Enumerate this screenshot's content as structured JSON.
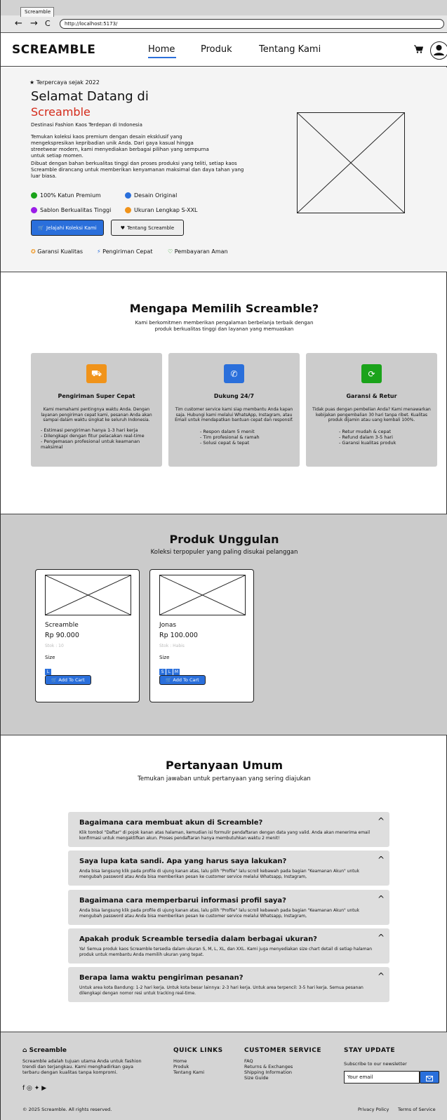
{
  "browser": {
    "tab_title": "Screamble",
    "back": "←",
    "forward": "→",
    "reload": "C",
    "url": "http://localhost:5173/"
  },
  "nav": {
    "brand": "SCREAMBLE",
    "links": [
      "Home",
      "Produk",
      "Tentang Kami"
    ],
    "active": "Home"
  },
  "hero": {
    "badge": "Terpercaya sejak 2022",
    "title_line1": "Selamat Datang di",
    "title_line2": "Screamble",
    "subtitle": "Destinasi Fashion Kaos Terdepan di Indonesia",
    "para1": "Temukan koleksi kaos premium dengan desain eksklusif yang mengekspresikan kepribadian unik Anda. Dari gaya kasual hingga streetwear modern, kami menyediakan berbagai pilihan yang sempurna untuk setiap momen.",
    "para2": "Dibuat dengan bahan berkualitas tinggi dan proses produksi yang teliti, setiap kaos Screamble dirancang untuk memberikan kenyamanan maksimal dan daya tahan yang luar biasa.",
    "features": [
      {
        "label": "100% Katun Premium",
        "color": "#1aa31a"
      },
      {
        "label": "Desain Original",
        "color": "#2a6fdb"
      },
      {
        "label": "Sablon Berkualitas Tinggi",
        "color": "#9b1de8"
      },
      {
        "label": "Ukuran Lengkap S-XXL",
        "color": "#f0931a"
      }
    ],
    "cta_primary": "Jelajahi Koleksi Kami",
    "cta_secondary": "Tentang Screamble",
    "trust": [
      "Garansi Kualitas",
      "Pengiriman Cepat",
      "Pembayaran Aman"
    ]
  },
  "why": {
    "title": "Mengapa Memilih Screamble?",
    "subtitle_line1": "Kami berkomitmen memberikan pengalaman berbelanja terbaik dengan",
    "subtitle_line2": "produk berkualitas tinggi dan layanan yang memuaskan",
    "cards": [
      {
        "icon": "truck-icon",
        "color": "#f0931a",
        "title": "Pengiriman Super Cepat",
        "desc": "Kami memahami pentingnya waktu Anda. Dengan layanan pengiriman cepat kami, pesanan Anda akan sampai dalam waktu singkat ke seluruh Indonesia.",
        "points": [
          "- Estimasi pengiriman hanya 1-3 hari kerja",
          "- Dilengkapi dengan fitur pelacakan real-time",
          "- Pengemasan profesional untuk keamanan maksimal"
        ]
      },
      {
        "icon": "phone-icon",
        "color": "#2a6fdb",
        "title": "Dukung 24/7",
        "desc": "Tim customer service kami siap membantu Anda kapan saja. Hubungi kami melalui WhatsApp, Instagram, atau Email untuk mendapatkan bantuan cepat dan responsif.",
        "points": [
          "- Respon dalam 5 menit",
          "- Tim profesional & ramah",
          "- Solusi cepat & tepat"
        ]
      },
      {
        "icon": "refresh-icon",
        "color": "#1aa31a",
        "title": "Garansi & Retur",
        "desc": "Tidak puas dengan pembelian Anda? Kami menawarkan kebijakan pengembalian 30 hari tanpa ribet. Kualitas produk dijamin atau uang kembali 100%.",
        "points": [
          "- Retur mudah & cepat",
          "- Refund dalam 3-5 hari",
          "- Garansi kualitas produk"
        ]
      }
    ]
  },
  "produk": {
    "title": "Produk Unggulan",
    "subtitle": "Koleksi terpopuler yang paling disukai pelanggan",
    "size_label": "Size",
    "add_label": "Add To Cart",
    "items": [
      {
        "name": "Screamble",
        "price": "Rp 90.000",
        "stock": "Stok : 10",
        "sizes": [
          "L"
        ]
      },
      {
        "name": "Jonas",
        "price": "Rp 100.000",
        "stock": "Stok : Habis",
        "sizes": [
          "S",
          "L",
          "M"
        ]
      }
    ]
  },
  "faq": {
    "title": "Pertanyaan Umum",
    "subtitle": "Temukan jawaban untuk pertanyaan yang sering diajukan",
    "items": [
      {
        "q": "Bagaimana cara membuat akun di Screamble?",
        "a": "Klik tombol \"Daftar\" di pojok kanan atas halaman, kemudian isi formulir pendaftaran dengan data yang valid. Anda akan menerima email konfirmasi untuk mengaktifkan akun. Proses pendaftaran hanya membutuhkan waktu 2 menit!"
      },
      {
        "q": "Saya lupa kata sandi. Apa yang harus saya lakukan?",
        "a": "Anda bisa langsung klik pada profile di ujung kanan atas, lalu pilih \"Profile\" lalu scroll kebawah pada bagian \"Keamanan Akun\" untuk mengubah password atau Anda bisa memberikan pesan ke customer service melalui Whatsapp, Instagram,"
      },
      {
        "q": "Bagaimana cara memperbarui informasi profil saya?",
        "a": "Anda bisa langsung klik pada profile di ujung kanan atas, lalu pilih \"Profile\" lalu scroll kebawah pada bagian \"Keamanan Akun\" untuk mengubah password atau Anda bisa memberikan pesan ke customer service melalui Whatsapp, Instagram,"
      },
      {
        "q": "Apakah produk Screamble tersedia dalam berbagai ukuran?",
        "a": "Ya! Semua produk kaos Screamble tersedia dalam ukuran S, M, L, XL, dan XXL. Kami juga menyediakan size chart detail di setiap halaman produk untuk membantu Anda memilih ukuran yang tepat."
      },
      {
        "q": "Berapa lama waktu pengiriman pesanan?",
        "a": "Untuk area kota Bandung: 1-2 hari kerja. Untuk kota besar lainnya: 2-3 hari kerja. Untuk area terpencil: 3-5 hari kerja. Semua pesanan dilengkapi dengan nomor resi untuk tracking real-time."
      }
    ]
  },
  "footer": {
    "brand": "Screamble",
    "about": "Screamble adalah tujuan utama Anda untuk fashion trendi dan terjangkau. Kami menghadirkan gaya terbaru dengan kualitas tanpa kompromi.",
    "quick_title": "QUICK LINKS",
    "quick_links": [
      "Home",
      "Produk",
      "Tentang Kami"
    ],
    "cs_title": "CUSTOMER SERVICE",
    "cs_links": [
      "FAQ",
      "Returns & Exchanges",
      "Shipping Information",
      "Size Guide"
    ],
    "stay_title": "STAY UPDATE",
    "newsletter_label": "Subscribe to our newsletter",
    "email_placeholder": "Your email",
    "copyright": "© 2025 Screamble. All rights reserved.",
    "privacy": "Privacy Policy",
    "terms": "Terms of Service"
  }
}
